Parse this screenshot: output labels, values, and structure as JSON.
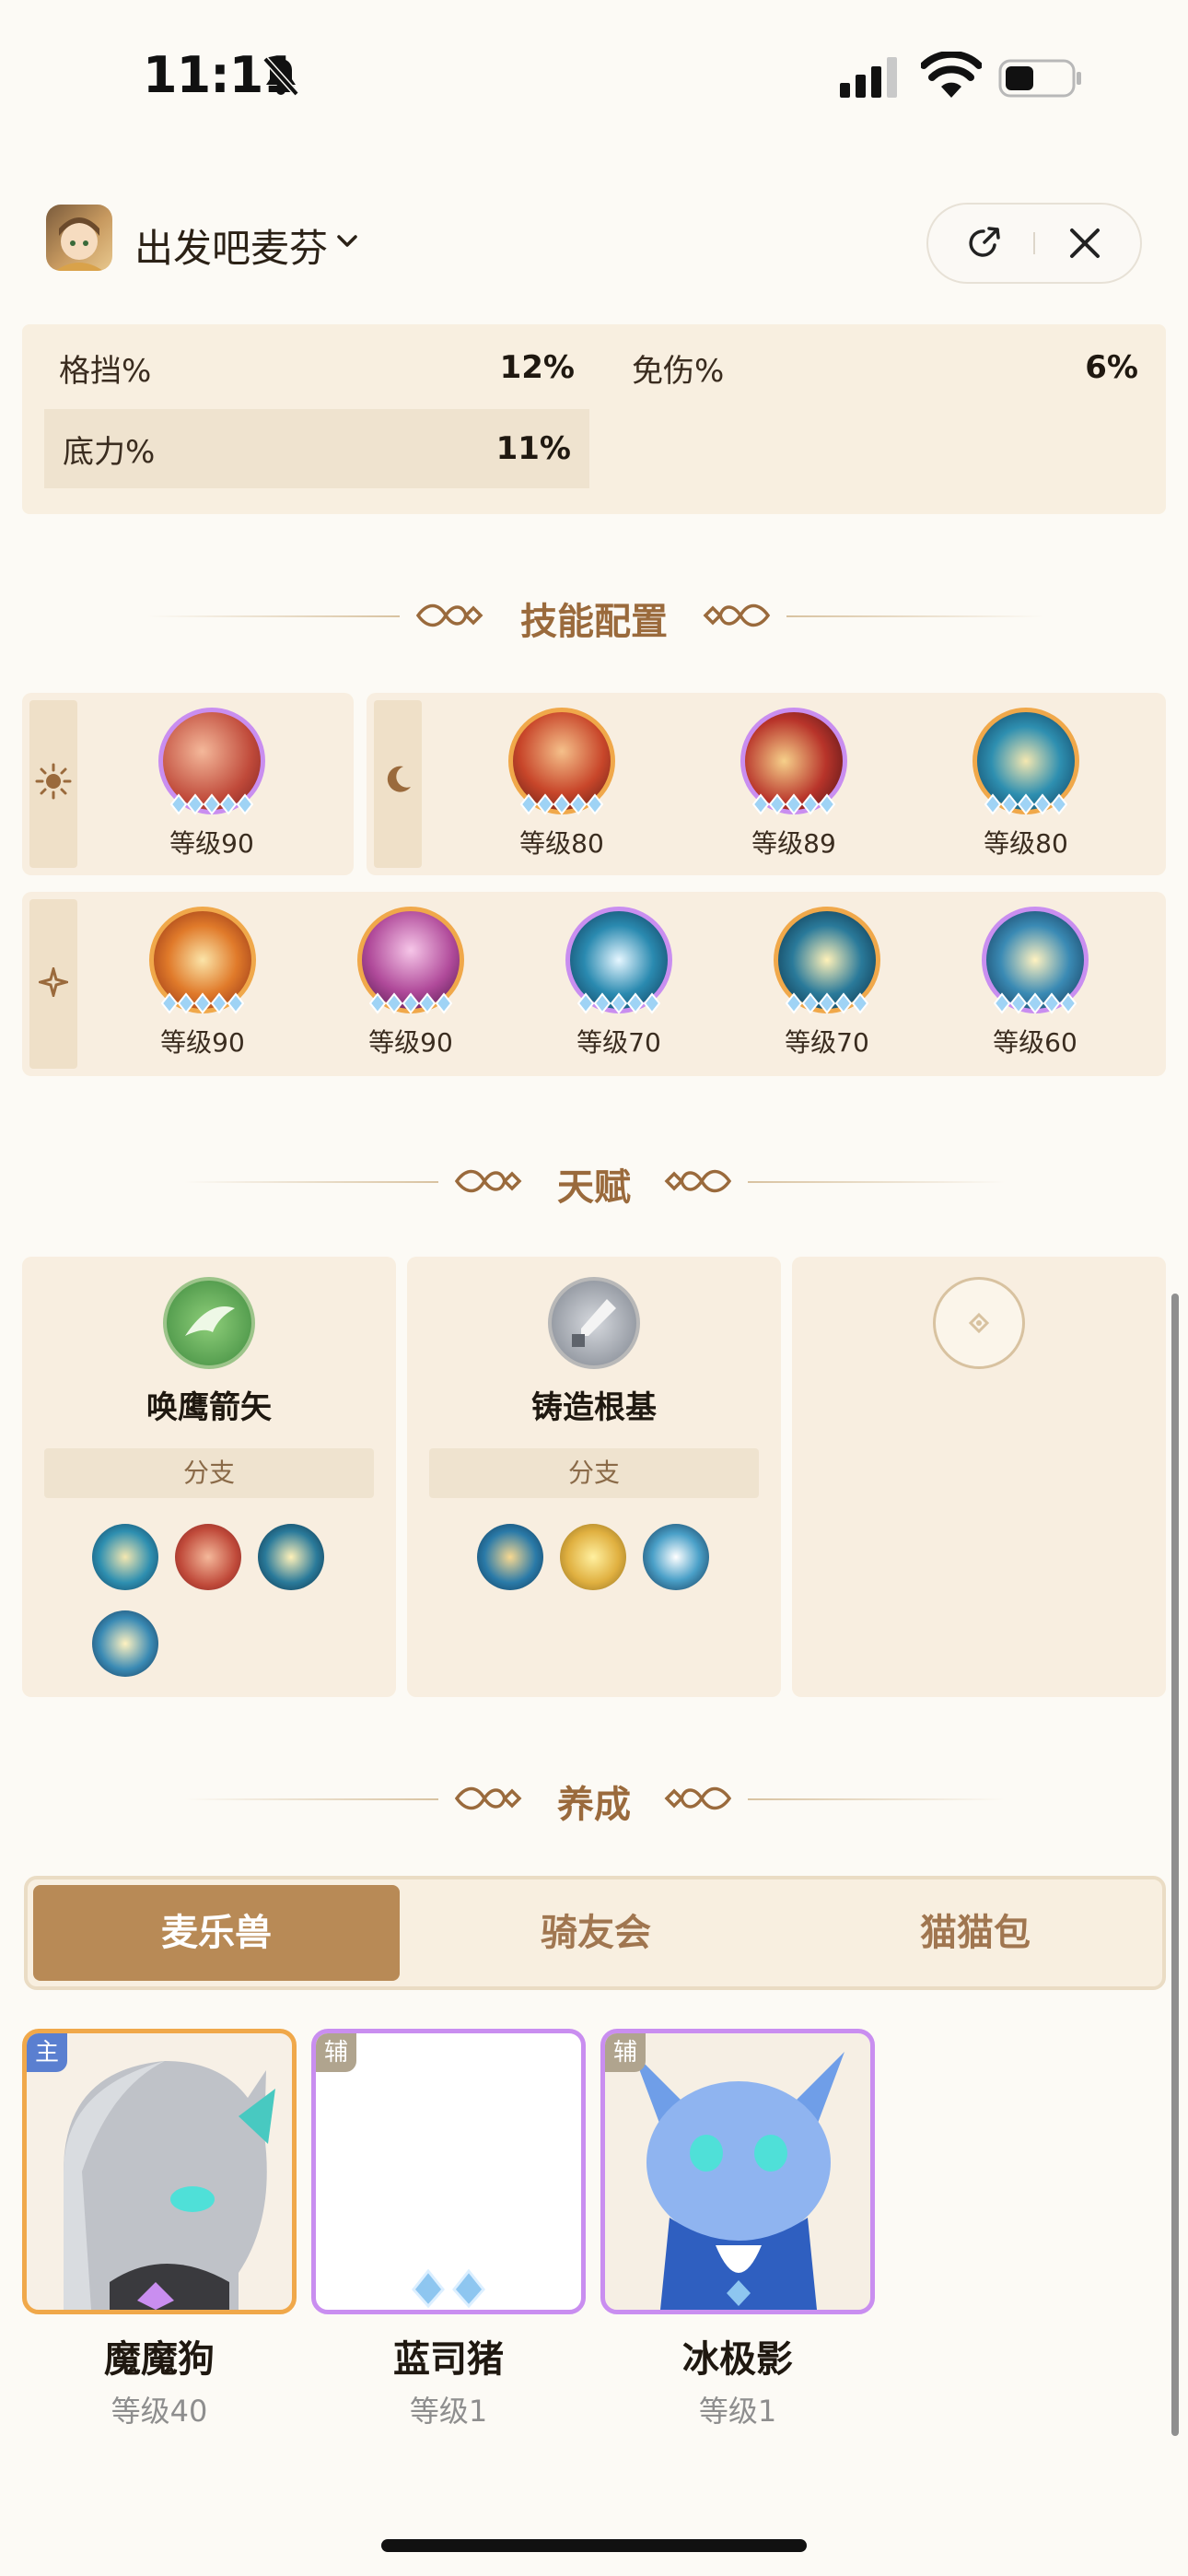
{
  "status_bar": {
    "time": "11:11"
  },
  "header": {
    "app_name": "出发吧麦芬"
  },
  "attributes": [
    {
      "label": "格挡%",
      "value": "12%"
    },
    {
      "label": "免伤%",
      "value": "6%"
    },
    {
      "label": "底力%",
      "value": "11%"
    }
  ],
  "skills_section": {
    "title": "技能配置",
    "sun_skills": [
      {
        "level": "等级90"
      }
    ],
    "moon_skills": [
      {
        "level": "等级80"
      },
      {
        "level": "等级89"
      },
      {
        "level": "等级80"
      }
    ],
    "star_skills": [
      {
        "level": "等级90"
      },
      {
        "level": "等级90"
      },
      {
        "level": "等级70"
      },
      {
        "level": "等级70"
      },
      {
        "level": "等级60"
      }
    ]
  },
  "talent_section": {
    "title": "天赋",
    "cards": [
      {
        "name": "唤鹰箭矢",
        "branch_label": "分支"
      },
      {
        "name": "铸造根基",
        "branch_label": "分支"
      }
    ]
  },
  "growth_section": {
    "title": "养成",
    "tabs": [
      {
        "label": "麦乐兽"
      },
      {
        "label": "骑友会"
      },
      {
        "label": "猫猫包"
      }
    ],
    "pets": [
      {
        "tag": "主",
        "name": "魔魔狗",
        "level": "等级40"
      },
      {
        "tag": "辅",
        "name": "蓝司猪",
        "level": "等级1"
      },
      {
        "tag": "辅",
        "name": "冰极影",
        "level": "等级1"
      }
    ]
  },
  "colors": {
    "accent": "#b88a56",
    "title_brown": "#9a6a3c",
    "panel": "#f8eee0",
    "orange_border": "#f0a84a",
    "purple_border": "#c98ef0",
    "main_tag": "#5a7fd0",
    "assist_tag": "#b0a48e"
  }
}
